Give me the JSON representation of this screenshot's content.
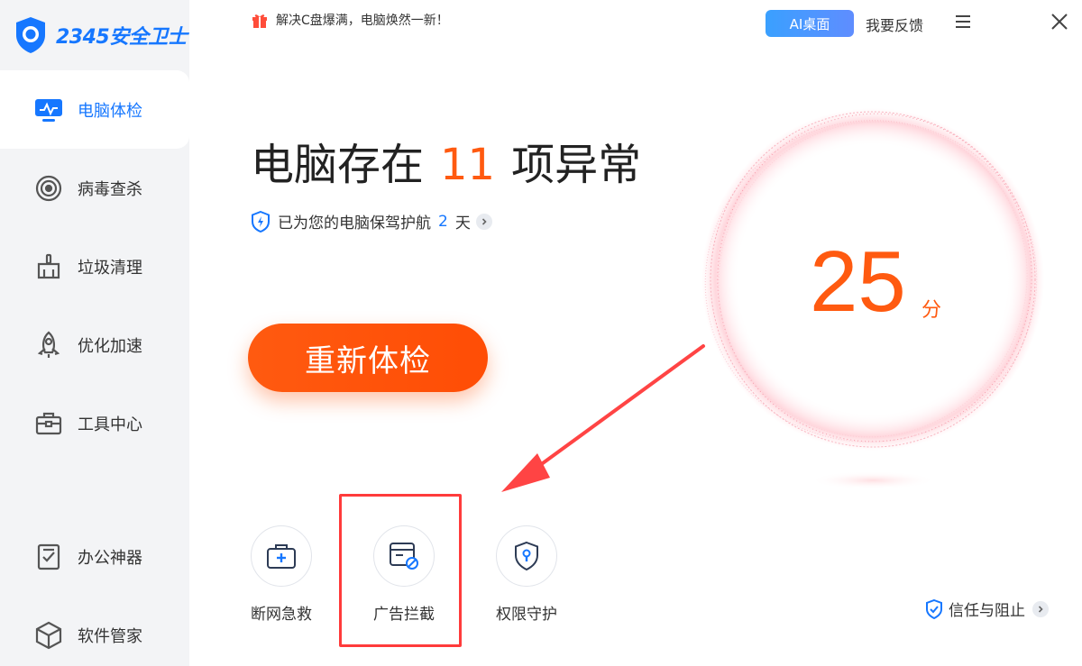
{
  "app": {
    "logo_text": "2345安全卫士"
  },
  "topbar": {
    "promo_text": "解决C盘爆满，电脑焕然一新！",
    "ai_button": "AI桌面",
    "feedback": "我要反馈"
  },
  "sidebar": {
    "items": [
      {
        "label": "电脑体检",
        "icon": "monitor-icon",
        "active": true
      },
      {
        "label": "病毒查杀",
        "icon": "target-icon",
        "active": false
      },
      {
        "label": "垃圾清理",
        "icon": "broom-icon",
        "active": false
      },
      {
        "label": "优化加速",
        "icon": "rocket-icon",
        "active": false
      },
      {
        "label": "工具中心",
        "icon": "toolbox-icon",
        "active": false
      },
      {
        "label": "办公神器",
        "icon": "checklist-icon",
        "active": false
      },
      {
        "label": "软件管家",
        "icon": "cube-icon",
        "active": false
      }
    ]
  },
  "main": {
    "headline_prefix": "电脑存在",
    "issue_count": "11",
    "headline_suffix": "项异常",
    "protect_text": "已为您的电脑保驾护航",
    "protect_days": "2",
    "protect_unit": "天",
    "recheck_button": "重新体检",
    "score": "25",
    "score_unit": "分"
  },
  "tools": [
    {
      "label": "断网急救",
      "icon": "first-aid-icon"
    },
    {
      "label": "广告拦截",
      "icon": "ad-block-icon",
      "highlighted": true
    },
    {
      "label": "权限守护",
      "icon": "shield-key-icon"
    }
  ],
  "trust": {
    "label": "信任与阻止"
  },
  "colors": {
    "accent": "#ff5a10",
    "brand_blue": "#1677ff",
    "highlight": "#ff3b3b"
  }
}
